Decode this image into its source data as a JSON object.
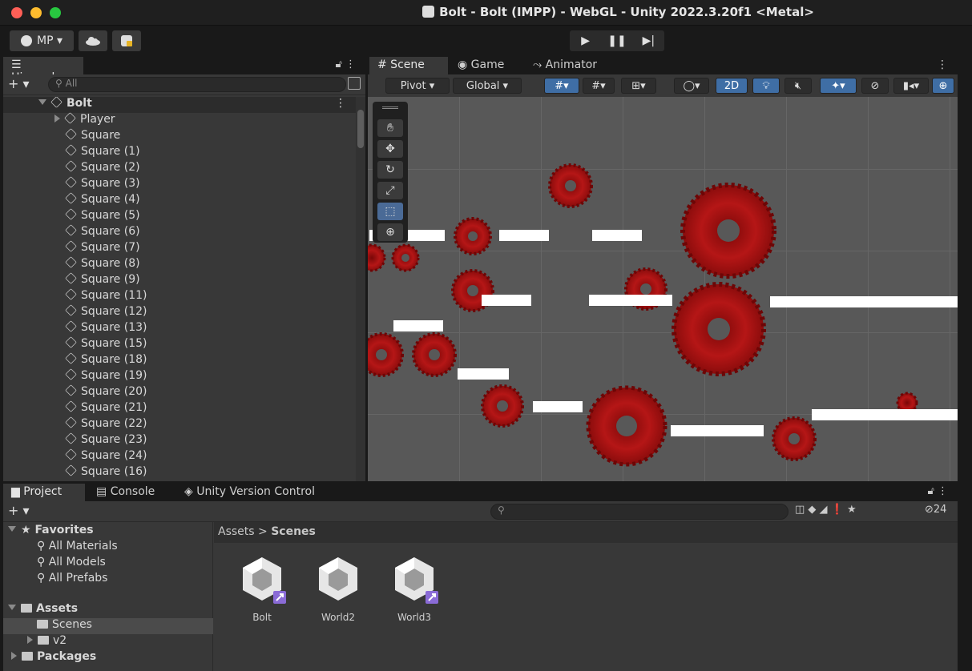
{
  "window": {
    "title": "Bolt - Bolt (IMPP) - WebGL - Unity 2022.3.20f1 <Metal>"
  },
  "toolbar": {
    "account_label": "MP ▾",
    "play_icons": [
      "▶",
      "❚❚",
      "▶|"
    ]
  },
  "hierarchy": {
    "tab_label": "☰ Hierarchy",
    "search_placeholder": "All",
    "items": [
      {
        "label": "Bolt",
        "type": "root"
      },
      {
        "label": "Player",
        "type": "collapsed"
      },
      {
        "label": "Square"
      },
      {
        "label": "Square (1)"
      },
      {
        "label": "Square (2)"
      },
      {
        "label": "Square (3)"
      },
      {
        "label": "Square (4)"
      },
      {
        "label": "Square (5)"
      },
      {
        "label": "Square (6)"
      },
      {
        "label": "Square (7)"
      },
      {
        "label": "Square (8)"
      },
      {
        "label": "Square (9)"
      },
      {
        "label": "Square (11)"
      },
      {
        "label": "Square (12)"
      },
      {
        "label": "Square (13)"
      },
      {
        "label": "Square (15)"
      },
      {
        "label": "Square (18)"
      },
      {
        "label": "Square (19)"
      },
      {
        "label": "Square (20)"
      },
      {
        "label": "Square (21)"
      },
      {
        "label": "Square (22)"
      },
      {
        "label": "Square (23)"
      },
      {
        "label": "Square (24)"
      },
      {
        "label": "Square (16)"
      }
    ]
  },
  "scene": {
    "tabs": [
      "# Scene",
      "Game",
      "Animator"
    ],
    "pivot_label": "Pivot ▾",
    "global_label": "Global ▾",
    "mode_2d": "2D"
  },
  "bottom": {
    "tabs": [
      "Project",
      "Console",
      "Unity Version Control"
    ],
    "hidden_count": "24",
    "favorites_label": "Favorites",
    "favorites": [
      "All Materials",
      "All Models",
      "All Prefabs"
    ],
    "assets_label": "Assets",
    "folders": [
      "Scenes",
      "v2"
    ],
    "packages_label": "Packages",
    "breadcrumb_root": "Assets",
    "breadcrumb_current": "Scenes",
    "scene_assets": [
      "Bolt",
      "World2",
      "World3"
    ]
  },
  "colors": {
    "saw_red": "#b01010",
    "selected_blue": "#3f6ea5",
    "scene_bg": "#585858"
  }
}
